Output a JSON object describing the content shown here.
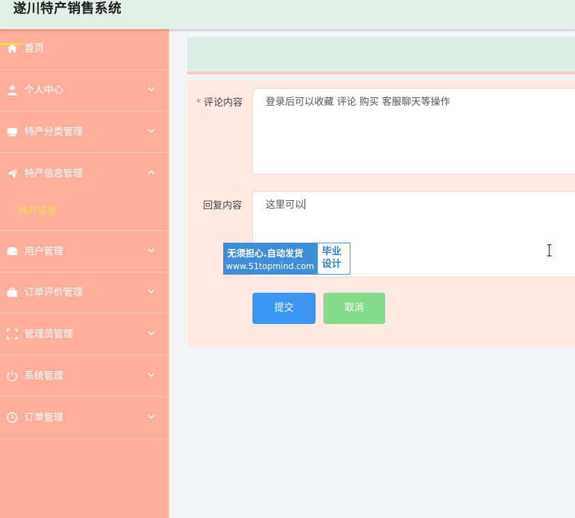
{
  "app": {
    "title": "遂川特产销售系统"
  },
  "sidebar": {
    "items": [
      {
        "label": "首页",
        "icon": "home-icon"
      },
      {
        "label": "个人中心",
        "icon": "user-icon"
      },
      {
        "label": "特产分类管理",
        "icon": "monitor-icon"
      },
      {
        "label": "特产信息管理",
        "icon": "send-icon",
        "expanded": true
      },
      {
        "label": "用户管理",
        "icon": "wallet-icon"
      },
      {
        "label": "订单评价管理",
        "icon": "briefcase-icon"
      },
      {
        "label": "管理员管理",
        "icon": "fullscreen-icon"
      },
      {
        "label": "系统管理",
        "icon": "power-icon"
      },
      {
        "label": "订单管理",
        "icon": "clock-icon"
      }
    ],
    "submenu": {
      "label": "特产信息"
    }
  },
  "form": {
    "comment": {
      "label": "评论内容",
      "required_mark": "*",
      "value": "登录后可以收藏   评论   购买   客服聊天等操作"
    },
    "reply": {
      "label": "回复内容",
      "value": "这里可以"
    },
    "submit_label": "提交",
    "cancel_label": "取消"
  },
  "watermark": {
    "line1": "无须担心.自动发货",
    "line2": "www.51topmind.com",
    "right1": "毕业",
    "right2": "设计"
  },
  "colors": {
    "sidebar_bg": "#ffb09a",
    "topbar_bg": "#e2efe9",
    "active_submenu": "#f7e14a",
    "submit": "#3a96f2",
    "cancel": "#85dd8b",
    "panel_bg": "#ffeae3"
  }
}
